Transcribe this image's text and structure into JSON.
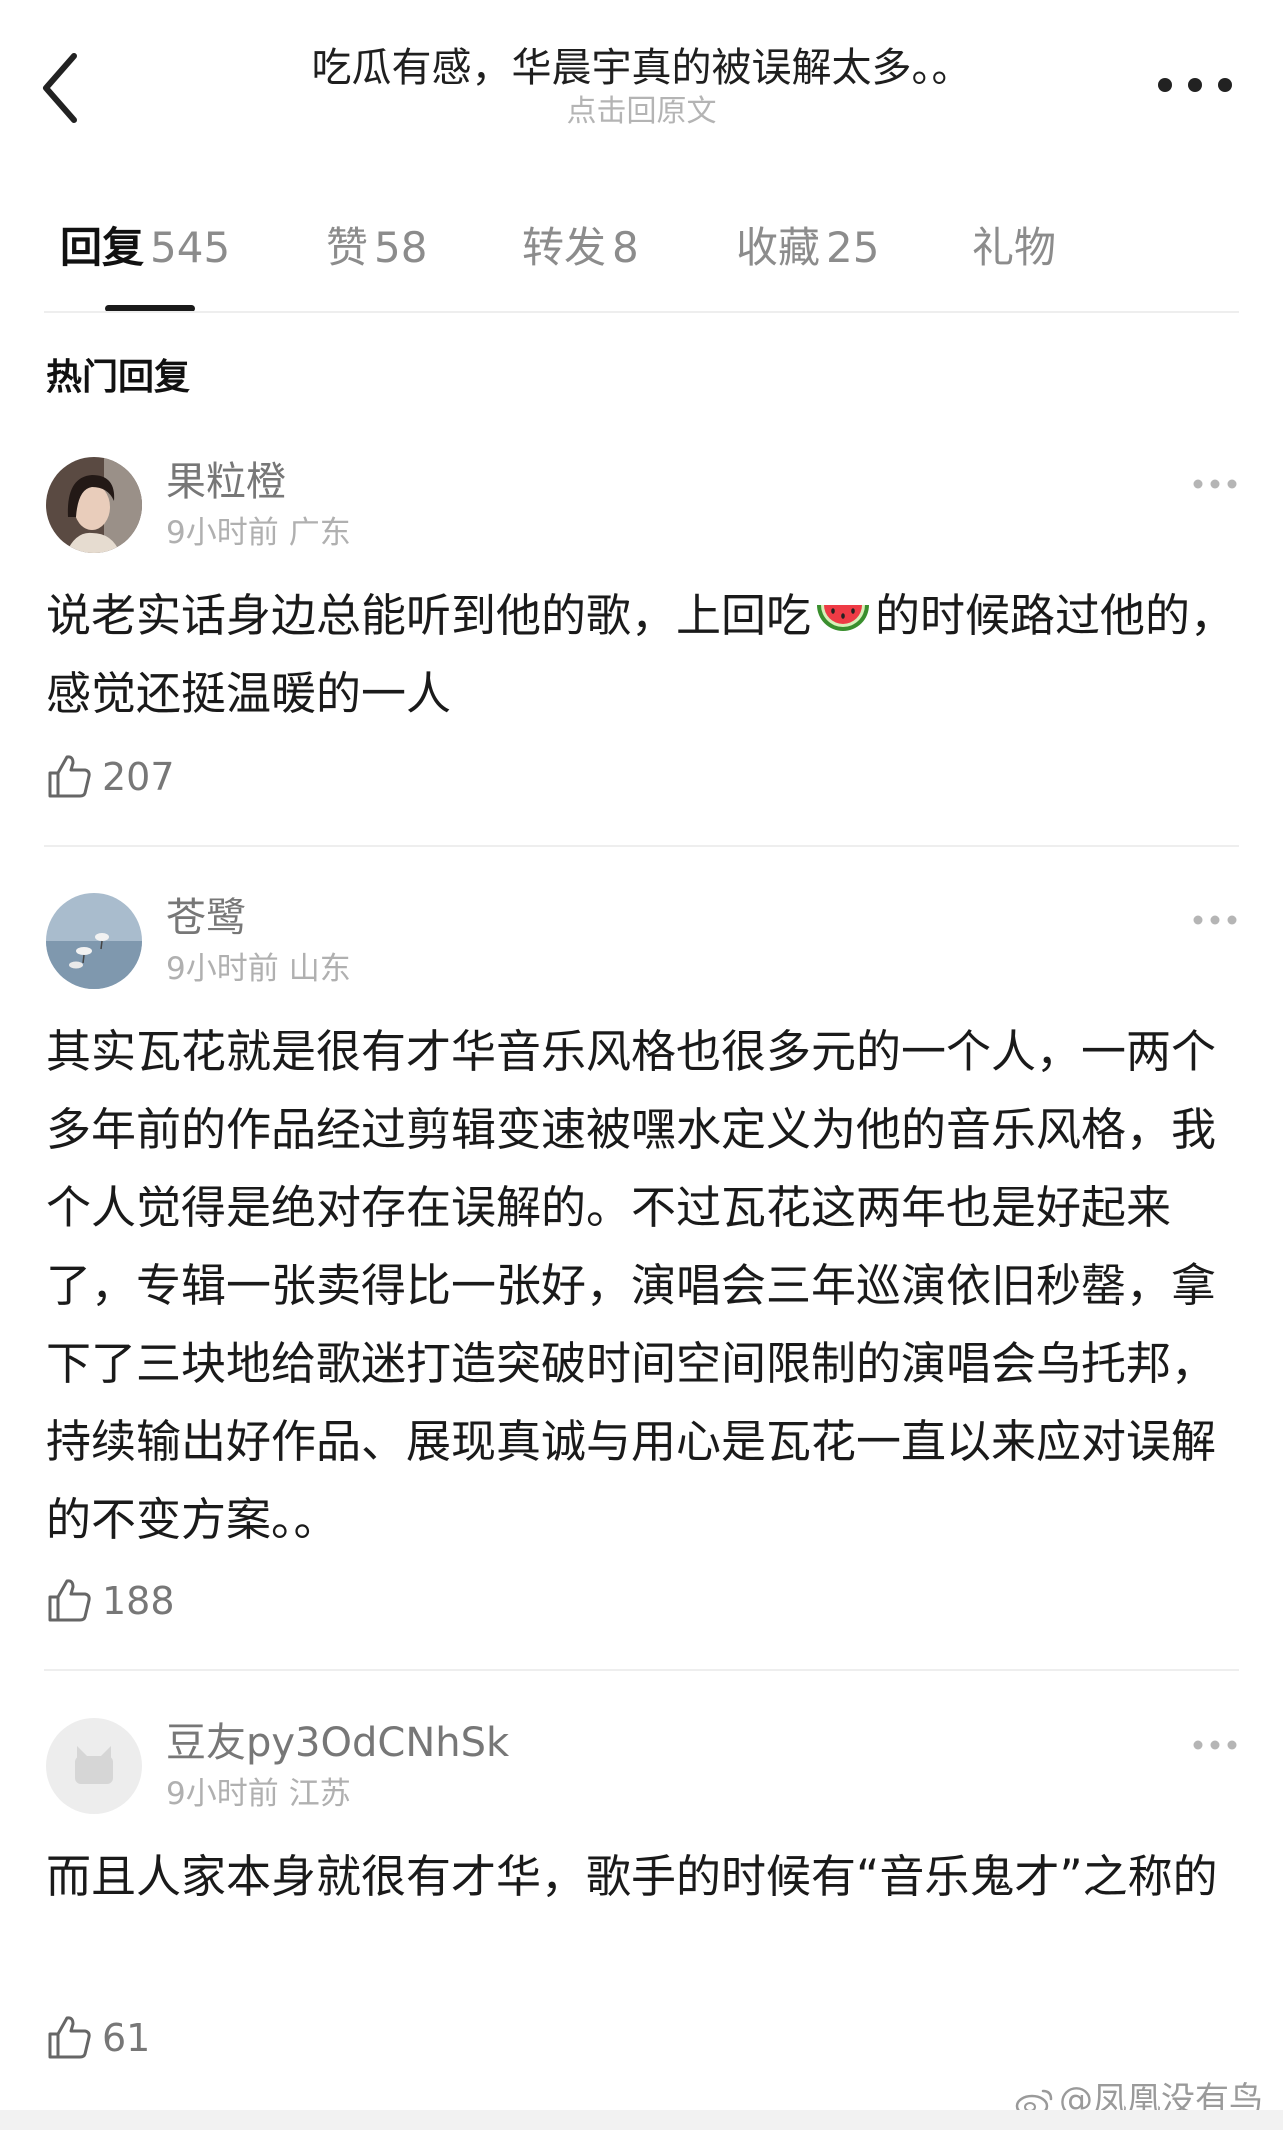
{
  "header": {
    "title": "吃瓜有感，华晨宇真的被误解太多。。",
    "subtitle": "点击回原文"
  },
  "tabs": [
    {
      "label": "回复",
      "count": "545"
    },
    {
      "label": "赞",
      "count": "58"
    },
    {
      "label": "转发",
      "count": "8"
    },
    {
      "label": "收藏",
      "count": "25"
    },
    {
      "label": "礼物",
      "count": ""
    }
  ],
  "section_title": "热门回复",
  "comments": [
    {
      "username": "果粒橙",
      "time": "9小时前",
      "location": "广东",
      "text_before_emoji": "说老实话身边总能听到他的歌，上回吃",
      "emoji": "watermelon-icon",
      "text_after_emoji": "的时候路过他的，感觉还挺温暖的一人",
      "likes": "207"
    },
    {
      "username": "苍鹭",
      "time": "9小时前",
      "location": "山东",
      "text": "其实瓦花就是很有才华音乐风格也很多元的一个人，一两个多年前的作品经过剪辑变速被嘿水定义为他的音乐风格，我个人觉得是绝对存在误解的。不过瓦花这两年也是好起来了，专辑一张卖得比一张好，演唱会三年巡演依旧秒罄，拿下了三块地给歌迷打造突破时间空间限制的演唱会乌托邦，持续输出好作品、展现真诚与用心是瓦花一直以来应对误解的不变方案。。",
      "likes": "188"
    },
    {
      "username": "豆友py3OdCNhSk",
      "time": "9小时前",
      "location": "江苏",
      "text": "而且人家本身就很有才华，歌手的时候有“音乐鬼才”之称的",
      "likes": "61"
    }
  ],
  "watermark": "@凤凰没有鸟",
  "colors": {
    "text_primary": "#1a1a1a",
    "text_secondary": "#777777",
    "text_muted": "#b0b0b0",
    "divider": "#eeeeee"
  }
}
